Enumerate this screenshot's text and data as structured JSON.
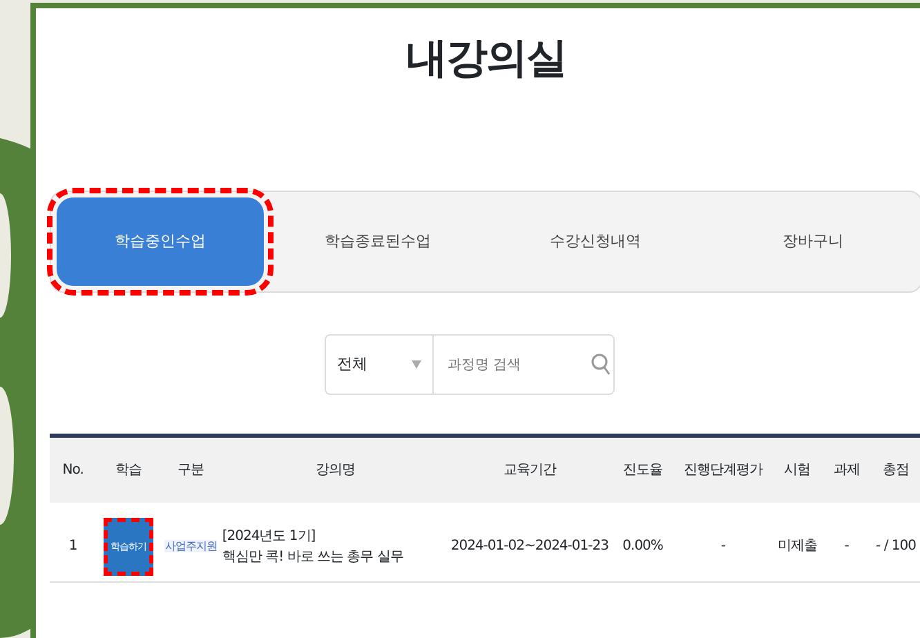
{
  "title": "내강의실",
  "tabs": [
    {
      "label": "학습중인수업",
      "selected": true,
      "highlighted": true
    },
    {
      "label": "학습종료된수업",
      "selected": false,
      "highlighted": false
    },
    {
      "label": "수강신청내역",
      "selected": false,
      "highlighted": false
    },
    {
      "label": "장바구니",
      "selected": false,
      "highlighted": false
    }
  ],
  "search": {
    "category": "전체",
    "placeholder": "과정명 검색"
  },
  "table": {
    "columns": [
      "No.",
      "학습",
      "구분",
      "강의명",
      "교육기간",
      "진도율",
      "진행단계평가",
      "시험",
      "과제",
      "총점"
    ],
    "rows": [
      {
        "no": "1",
        "action": {
          "label": "학습하기",
          "highlighted": true
        },
        "category": "사업주지원",
        "course_term": "[2024년도 1기]",
        "course_name": "핵심만 콕! 바로 쓰는 총무 실무",
        "period": "2024-01-02~2024-01-23",
        "progress": "0.00%",
        "stage_eval": "-",
        "exam": "미제출",
        "assignment": "-",
        "score": "- / 100"
      }
    ]
  }
}
